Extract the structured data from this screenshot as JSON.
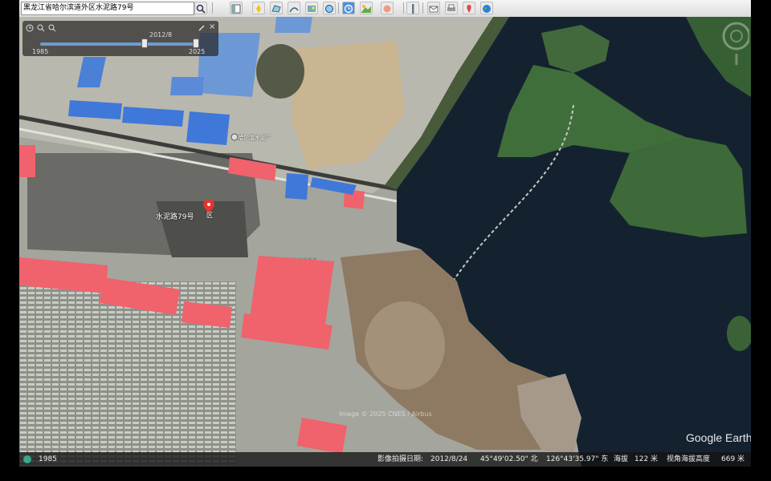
{
  "search": {
    "value": "黑龙江省哈尔滨道外区水泥路79号"
  },
  "toolbar": {
    "buttons": [
      "search-icon",
      "sidebar-icon",
      "placemark-icon",
      "polygon-icon",
      "path-icon",
      "overlay-icon",
      "tour-icon",
      "history-icon",
      "sun-icon",
      "planets-icon",
      "ruler-icon",
      "email-icon",
      "print-icon",
      "maps-icon",
      "earth-icon"
    ]
  },
  "time_slider": {
    "current": "2012/8",
    "start": "1985",
    "end": "2025",
    "close": "×"
  },
  "map": {
    "pin_label": "水泥路79号",
    "pin_sub": "区",
    "poi_label": "哈尔滨水泥厂",
    "credit": "Image © 2025 CNES / Airbus",
    "watermark": "Google Earth"
  },
  "status": {
    "year": "1985",
    "imagery_date_label": "影像拍摄日期:",
    "imagery_date": "2012/8/24",
    "lat": "45°49'02.50\" 北",
    "lon": "126°43'35.97\" 东",
    "elev_label": "海拔",
    "elev": "122 米",
    "eye_label": "视角海拔高度",
    "eye": "669 米"
  },
  "colors": {
    "water": "#142230",
    "roof_red": "#f0626c",
    "roof_blue": "#3f78d8",
    "vegetation": "#3f6e3a"
  }
}
